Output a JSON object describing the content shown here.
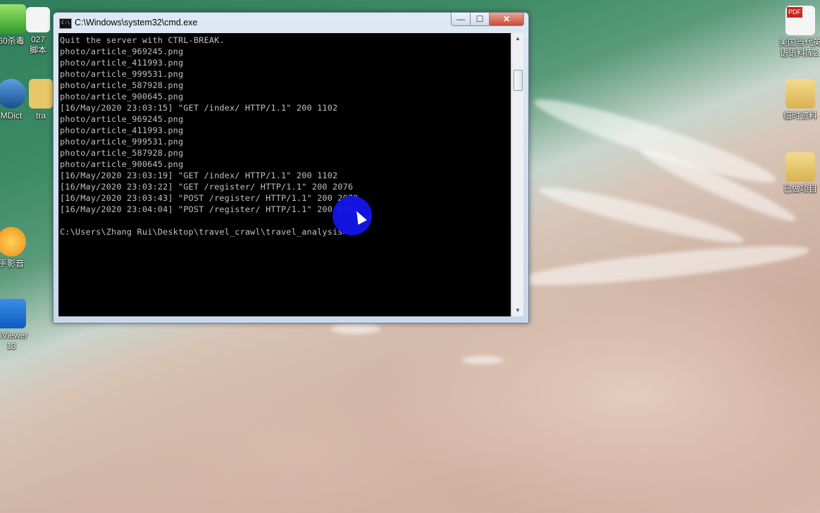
{
  "desktop": {
    "icons_left": [
      {
        "label": "60杀毒",
        "icon": "shield-icon"
      },
      {
        "label": "027",
        "icon": "pdf-file-icon"
      },
      {
        "label": "脚本",
        "icon": "script-icon"
      },
      {
        "label": "MDict",
        "icon": "mdict-icon"
      },
      {
        "label": "tra",
        "icon": "folder-icon"
      },
      {
        "label": "手影音",
        "icon": "media-player-icon"
      },
      {
        "label": "mViewer",
        "icon": "teamviewer-icon"
      },
      {
        "label": "13",
        "icon": "teamviewer-version-text"
      }
    ],
    "icons_right": [
      {
        "label_line1": "美国当代英",
        "label_line2": "语语料库2.",
        "icon": "pdf-icon",
        "badge": "PDF"
      },
      {
        "label": "临时资料",
        "icon": "folder-icon"
      },
      {
        "label": "已做项目",
        "icon": "folder-icon"
      }
    ]
  },
  "window": {
    "title": "C:\\Windows\\system32\\cmd.exe",
    "icon_text": "C:\\",
    "controls": {
      "minimize": "—",
      "maximize": "☐",
      "close": "✕"
    },
    "lines": [
      "Quit the server with CTRL-BREAK.",
      "photo/article_969245.png",
      "photo/article_411993.png",
      "photo/article_999531.png",
      "photo/article_587928.png",
      "photo/article_900645.png",
      "[16/May/2020 23:03:15] \"GET /index/ HTTP/1.1\" 200 1102",
      "photo/article_969245.png",
      "photo/article_411993.png",
      "photo/article_999531.png",
      "photo/article_587928.png",
      "photo/article_900645.png",
      "[16/May/2020 23:03:19] \"GET /index/ HTTP/1.1\" 200 1102",
      "[16/May/2020 23:03:22] \"GET /register/ HTTP/1.1\" 200 2076",
      "[16/May/2020 23:03:43] \"POST /register/ HTTP/1.1\" 200 2079",
      "[16/May/2020 23:04:04] \"POST /register/ HTTP/1.1\" 200 2103",
      "",
      "C:\\Users\\Zhang Rui\\Desktop\\travel_crawl\\travel_analysis>"
    ],
    "scroll_up": "▲",
    "scroll_down": "▼"
  }
}
